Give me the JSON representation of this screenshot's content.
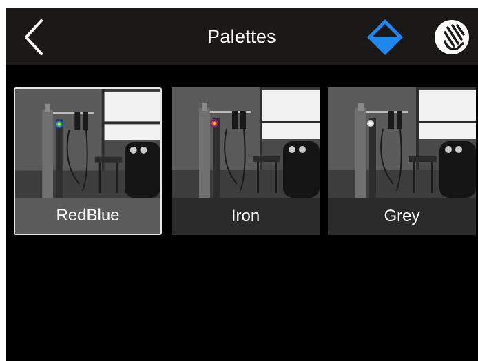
{
  "header": {
    "title": "Palettes",
    "accent_color": "#1e88f0",
    "icons": {
      "back": "chevron-left-icon",
      "level": "level-diamond-icon",
      "touch": "touch-hand-icon"
    }
  },
  "palettes": [
    {
      "name": "RedBlue",
      "selected": true
    },
    {
      "name": "Iron",
      "selected": false
    },
    {
      "name": "Grey",
      "selected": false
    }
  ]
}
